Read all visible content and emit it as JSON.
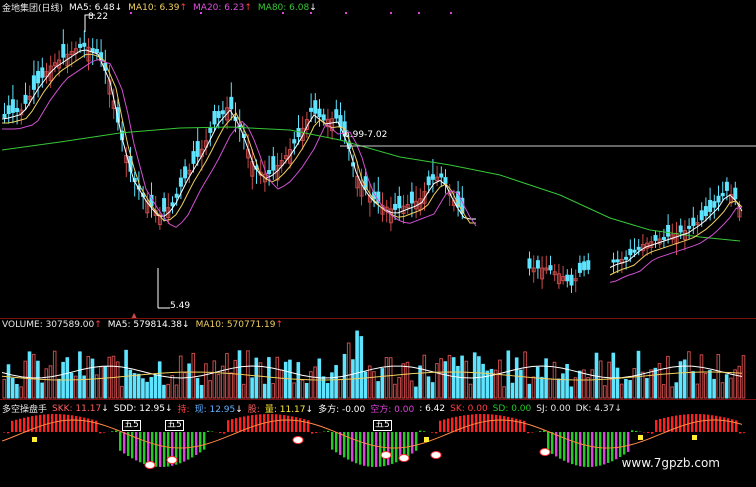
{
  "colors": {
    "background": "#000000",
    "up": "#c84a4a",
    "down": "#5fe4ff",
    "ma5": "#ffffff",
    "ma10": "#f0d060",
    "ma20": "#d050d0",
    "ma80": "#36c836",
    "separator": "#7a1010",
    "red_bar": "#ff2020",
    "green_bar": "#22cc22",
    "magenta_bar": "#dd44dd",
    "yellow_marker": "#ffee33"
  },
  "price_panel": {
    "title": "金地集团(日线)",
    "ma5_label": "MA5: 6.48",
    "ma5_arrow": "↓",
    "ma10_label": "MA10: 6.39",
    "ma10_arrow": "↑",
    "ma20_label": "MA20: 6.23",
    "ma20_arrow": "↑",
    "ma80_label": "MA80: 6.08",
    "ma80_arrow": "↓",
    "high_label": "8.22",
    "low_label": "5.49",
    "level_label": "6.99-7.02"
  },
  "volume_panel": {
    "volume_label": "VOLUME: 307589.00",
    "volume_arrow": "↑",
    "ma5_label": "MA5: 579814.38",
    "ma5_arrow": "↓",
    "ma10_label": "MA10: 570771.19",
    "ma10_arrow": "↑"
  },
  "indicator_panel": {
    "name": "多空操盘手",
    "skk_label": "SKK: 11.17",
    "skk_arrow": "↓",
    "sdd_label": "SDD: 12.95",
    "sdd_arrow": "↓",
    "long_label": "持:",
    "now_label": "现: 12.95",
    "now_arrow": "↓",
    "stock_label": "股:",
    "hold_label": "量: 11.17",
    "hold_arrow": "↓",
    "duofang_label": "多方: -0.00",
    "kongfang_label": "空方: 0.00",
    "kongfang_val": ": 6.42",
    "sk_label": "SK: 0.00",
    "sd_label": "SD: 0.00",
    "sj_label": "SJ: 0.00",
    "dk_label": "DK: 4.37",
    "dk_arrow": "↓",
    "marker_label": "五",
    "marker_number": "5"
  },
  "watermark": "www.7gpzb.com"
}
